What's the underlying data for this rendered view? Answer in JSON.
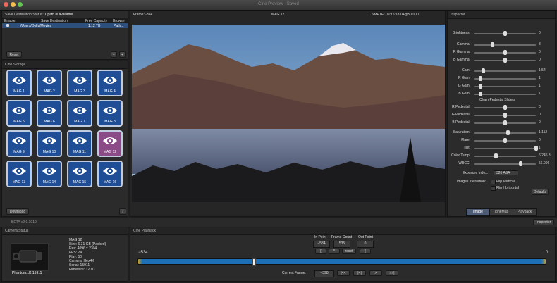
{
  "window": {
    "title": "Cine Preview - Saved"
  },
  "destination": {
    "status_label": "Save Destination Status:",
    "status_value": "1 path is available.",
    "columns": [
      "Enable",
      "Save Destination",
      "Free Capacity",
      "Browse"
    ],
    "row": {
      "path": "/Users/Dolly/Movies",
      "capacity": "1.12 TB",
      "browse": "Path..."
    },
    "reset": "Reset",
    "minus": "−",
    "plus": "+"
  },
  "storage": {
    "header": "Cine Storage",
    "mags": [
      "MAG 1",
      "MAG 2",
      "MAG 3",
      "MAG 4",
      "MAG 5",
      "MAG 6",
      "MAG 7",
      "MAG 8",
      "MAG 9",
      "MAG 10",
      "MAG 11",
      "MAG 12",
      "MAG 13",
      "MAG 14",
      "MAG 15",
      "MAG 16"
    ],
    "selected": "MAG 12",
    "download": "Download",
    "download_icon": "download-arrow-icon"
  },
  "viewer": {
    "frame": "Frame: -394",
    "mag": "MAG 12",
    "smpte": "SMPTE: 09:15:18:04@50.000"
  },
  "inspector": {
    "header": "Inspector",
    "sliders": [
      {
        "label": "Brightness:",
        "value": "0",
        "pos": 0.5
      },
      {
        "label": "Gamma:",
        "value": "3",
        "pos": 0.3
      },
      {
        "label": "R Gamma:",
        "value": "0",
        "pos": 0.5
      },
      {
        "label": "B Gamma:",
        "value": "0",
        "pos": 0.5
      },
      {
        "label": "Gain:",
        "value": "1.54",
        "pos": 0.15
      },
      {
        "label": "R Gain:",
        "value": "1",
        "pos": 0.1
      },
      {
        "label": "G Gain:",
        "value": "1",
        "pos": 0.1
      },
      {
        "label": "B Gain:",
        "value": "1",
        "pos": 0.1
      },
      {
        "label": "R Pedestal:",
        "value": "0",
        "pos": 0.5
      },
      {
        "label": "G Pedestal:",
        "value": "0",
        "pos": 0.5
      },
      {
        "label": "B Pedestal:",
        "value": "0",
        "pos": 0.5
      },
      {
        "label": "Saturation:",
        "value": "1.112",
        "pos": 0.55
      },
      {
        "label": "Flare:",
        "value": "0",
        "pos": 0.5
      },
      {
        "label": "Tint:",
        "value": "1",
        "pos": 1.0
      },
      {
        "label": "Color Temp:",
        "value": "6,245.3",
        "pos": 0.35
      },
      {
        "label": "WBCC:",
        "value": "56.996",
        "pos": 0.75
      }
    ],
    "chain_label": "Chain Pedestal Sliders",
    "exposure_label": "Exposure Index:",
    "exposure_value": "320 ASA",
    "orientation_label": "Image Orientation:",
    "flip_vertical": "Flip Vertical",
    "flip_horizontal": "Flip Horizontal",
    "defaults": "Defaults",
    "tabs": [
      "Image",
      "ToneMap",
      "Playback"
    ]
  },
  "beta": "BETA v2.0.1010",
  "inspector_btn": "Inspector",
  "camera": {
    "header": "Camera Status",
    "name": "Phantom...K 15911",
    "mag": "MAG 12",
    "size": "Size: 6.31 GB (Packed)",
    "res": "Res: 4096 x 2304",
    "fps": "FPS: 24",
    "play": "Play: 50",
    "camera": "Camera: Hex4K",
    "serial": "Serial: 15911",
    "firmware": "Firmware: 12011"
  },
  "playback": {
    "header": "Cine Playback",
    "in_label": "In Point",
    "count_label": "Frame Count",
    "out_label": "Out Point",
    "in_value": "−534",
    "count_value": "535",
    "out_value": "0",
    "btn_in": "[",
    "btn_up": "^",
    "btn_reset": "reset",
    "btn_out": "]",
    "start": "−534",
    "end": "0",
    "current_label": "Current Frame:",
    "current_value": "−398",
    "ctrl1": "|<<",
    "ctrl2": "|<|",
    "ctrl3": ">",
    "ctrl4": ">>|",
    "playhead_frac": 0.28
  },
  "colors": {
    "timeline": "#1f6fb5",
    "timeline_end": "#c9a227",
    "mag_blue": "#1f4e96",
    "mag_selected": "#8a4b86"
  }
}
